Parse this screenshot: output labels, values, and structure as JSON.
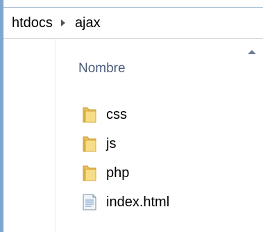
{
  "breadcrumb": {
    "items": [
      {
        "label": "htdocs"
      },
      {
        "label": "ajax"
      }
    ]
  },
  "header": {
    "column_name": "Nombre"
  },
  "files": [
    {
      "name": "css",
      "icon": "folder-icon"
    },
    {
      "name": "js",
      "icon": "folder-icon"
    },
    {
      "name": "php",
      "icon": "folder-icon"
    },
    {
      "name": "index.html",
      "icon": "html-file-icon"
    }
  ],
  "colors": {
    "accent": "#7fa6cf",
    "header_text": "#4a5a7a",
    "folder": "#f5d77a"
  }
}
